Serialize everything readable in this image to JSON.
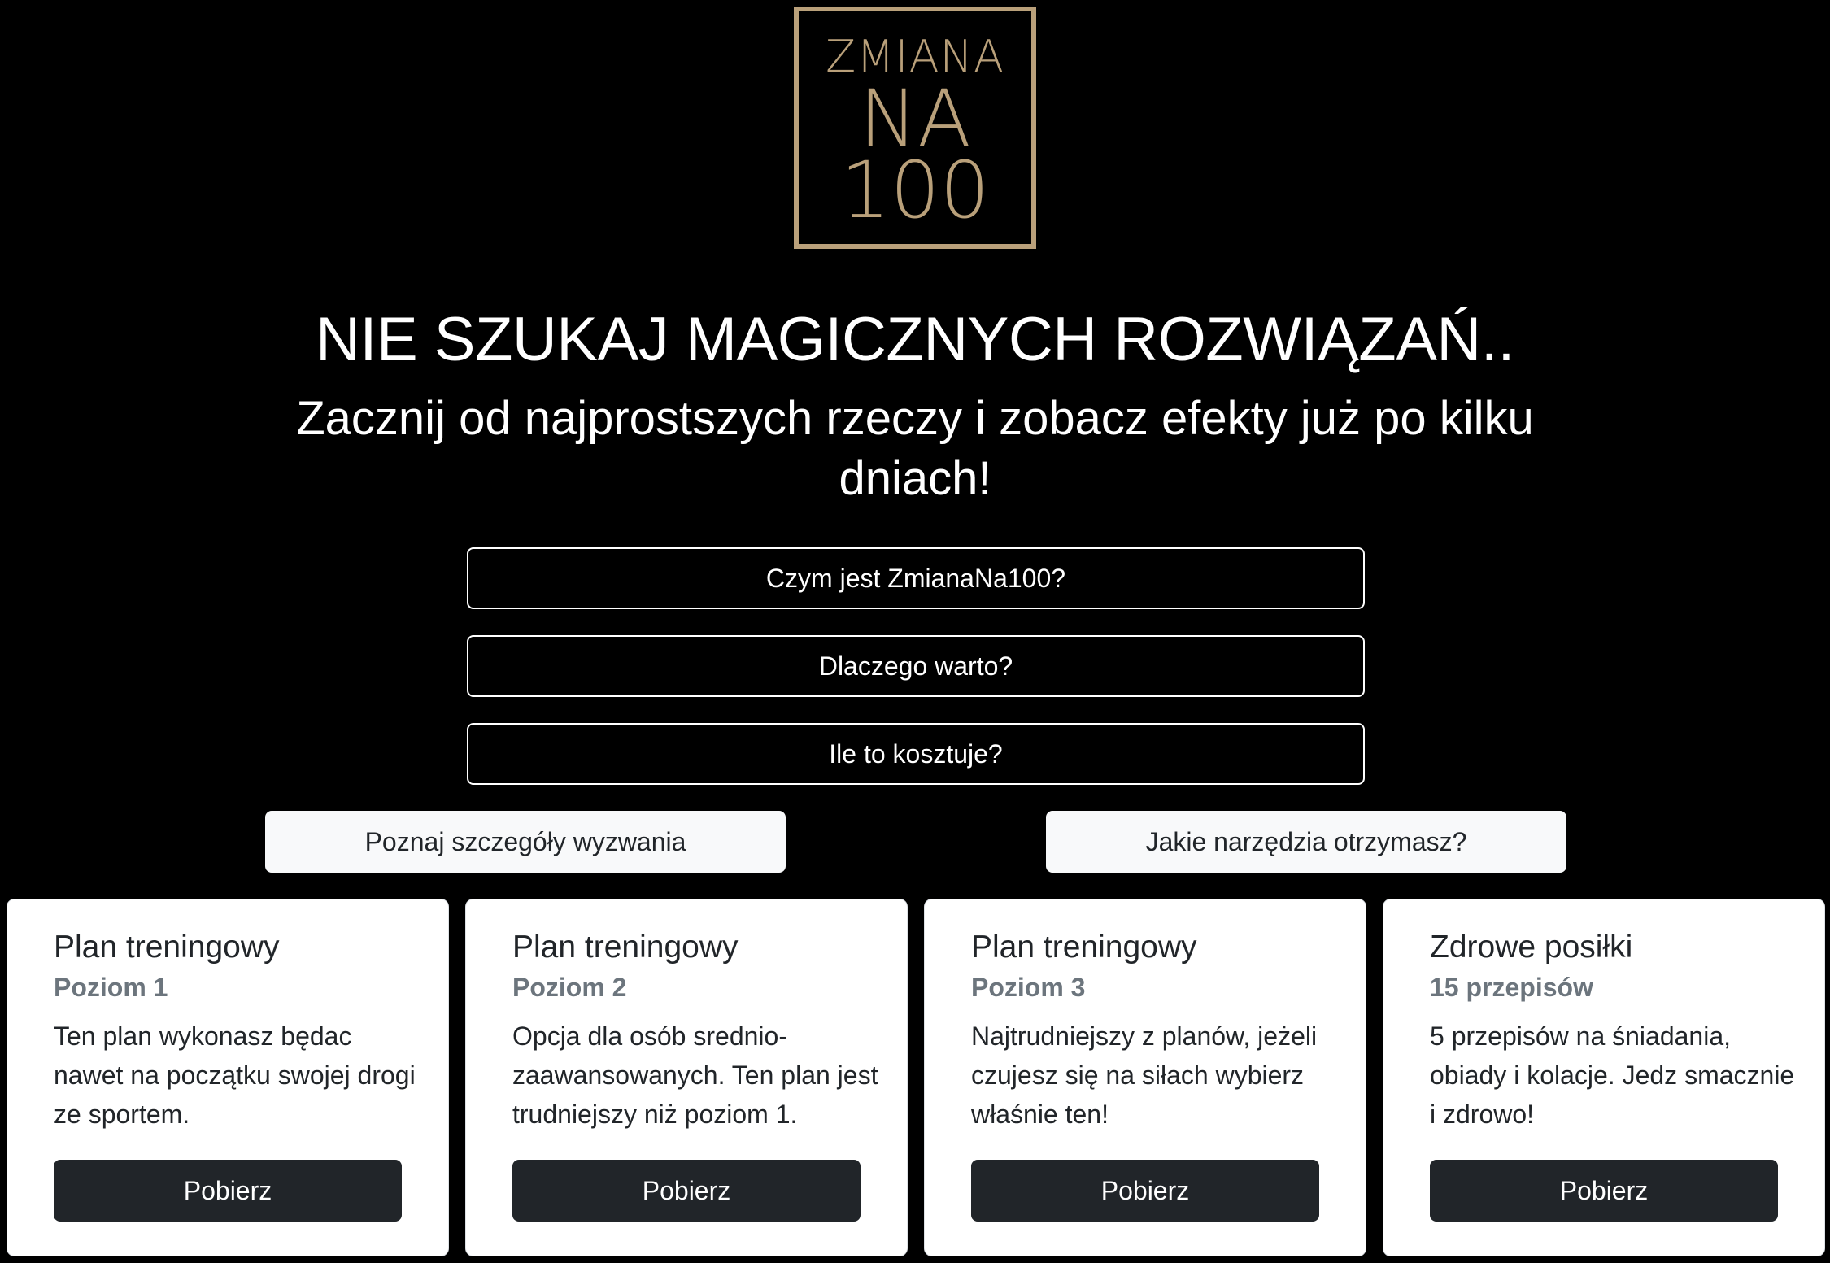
{
  "logo": {
    "line1": "ZMIANA",
    "line2": "NA",
    "line3": "100",
    "color": "#b9a07a"
  },
  "hero": {
    "headline": "NIE SZUKAJ MAGICZNYCH ROZWIĄZAŃ..",
    "subline": "Zacznij od najprostszych rzeczy i zobacz efekty już po kilku dniach!"
  },
  "outline_buttons": [
    {
      "label": "Czym jest ZmianaNa100?"
    },
    {
      "label": "Dlaczego warto?"
    },
    {
      "label": "Ile to kosztuje?"
    }
  ],
  "light_buttons": [
    {
      "label": "Poznaj szczegóły wyzwania"
    },
    {
      "label": "Jakie narzędzia otrzymasz?"
    }
  ],
  "cards": [
    {
      "title": "Plan treningowy",
      "subtitle": "Poziom 1",
      "text": "Ten plan wykonasz będac nawet na początku swojej drogi ze sportem.",
      "button": "Pobierz"
    },
    {
      "title": "Plan treningowy",
      "subtitle": "Poziom 2",
      "text": "Opcja dla osób srednio-zaawansowanych. Ten plan jest trudniejszy niż poziom 1.",
      "button": "Pobierz"
    },
    {
      "title": "Plan treningowy",
      "subtitle": "Poziom 3",
      "text": "Najtrudniejszy z planów, jeżeli czujesz się na siłach wybierz właśnie ten!",
      "button": "Pobierz"
    },
    {
      "title": "Zdrowe posiłki",
      "subtitle": "15 przepisów",
      "text": "5 przepisów na śniadania, obiady i kolacje. Jedz smacznie i zdrowo!",
      "button": "Pobierz"
    }
  ],
  "colors": {
    "background": "#000000",
    "gold": "#b9a07a",
    "dark_button": "#212529",
    "light_button": "#f8f9fa",
    "muted_text": "#6c757d"
  }
}
